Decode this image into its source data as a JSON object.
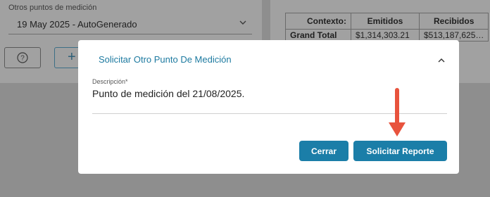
{
  "background": {
    "select": {
      "label": "Otros puntos de medición",
      "value": "19 May 2025 - AutoGenerado"
    },
    "help_icon": "question-circle-icon",
    "add_button_label": "+",
    "table": {
      "headers": [
        "Contexto:",
        "Emitidos",
        "Recibidos"
      ],
      "rows": [
        [
          "Grand Total",
          "$1,314,303.21",
          "$513,187,625…"
        ]
      ]
    }
  },
  "modal": {
    "title": "Solicitar Otro Punto De Medición",
    "collapse_icon": "chevron-up-icon",
    "field_label": "Descripción*",
    "field_value": "Punto de medición del 21/08/2025.",
    "close_label": "Cerrar",
    "submit_label": "Solicitar Reporte"
  },
  "annotation": {
    "arrow_color": "#e8533d"
  }
}
